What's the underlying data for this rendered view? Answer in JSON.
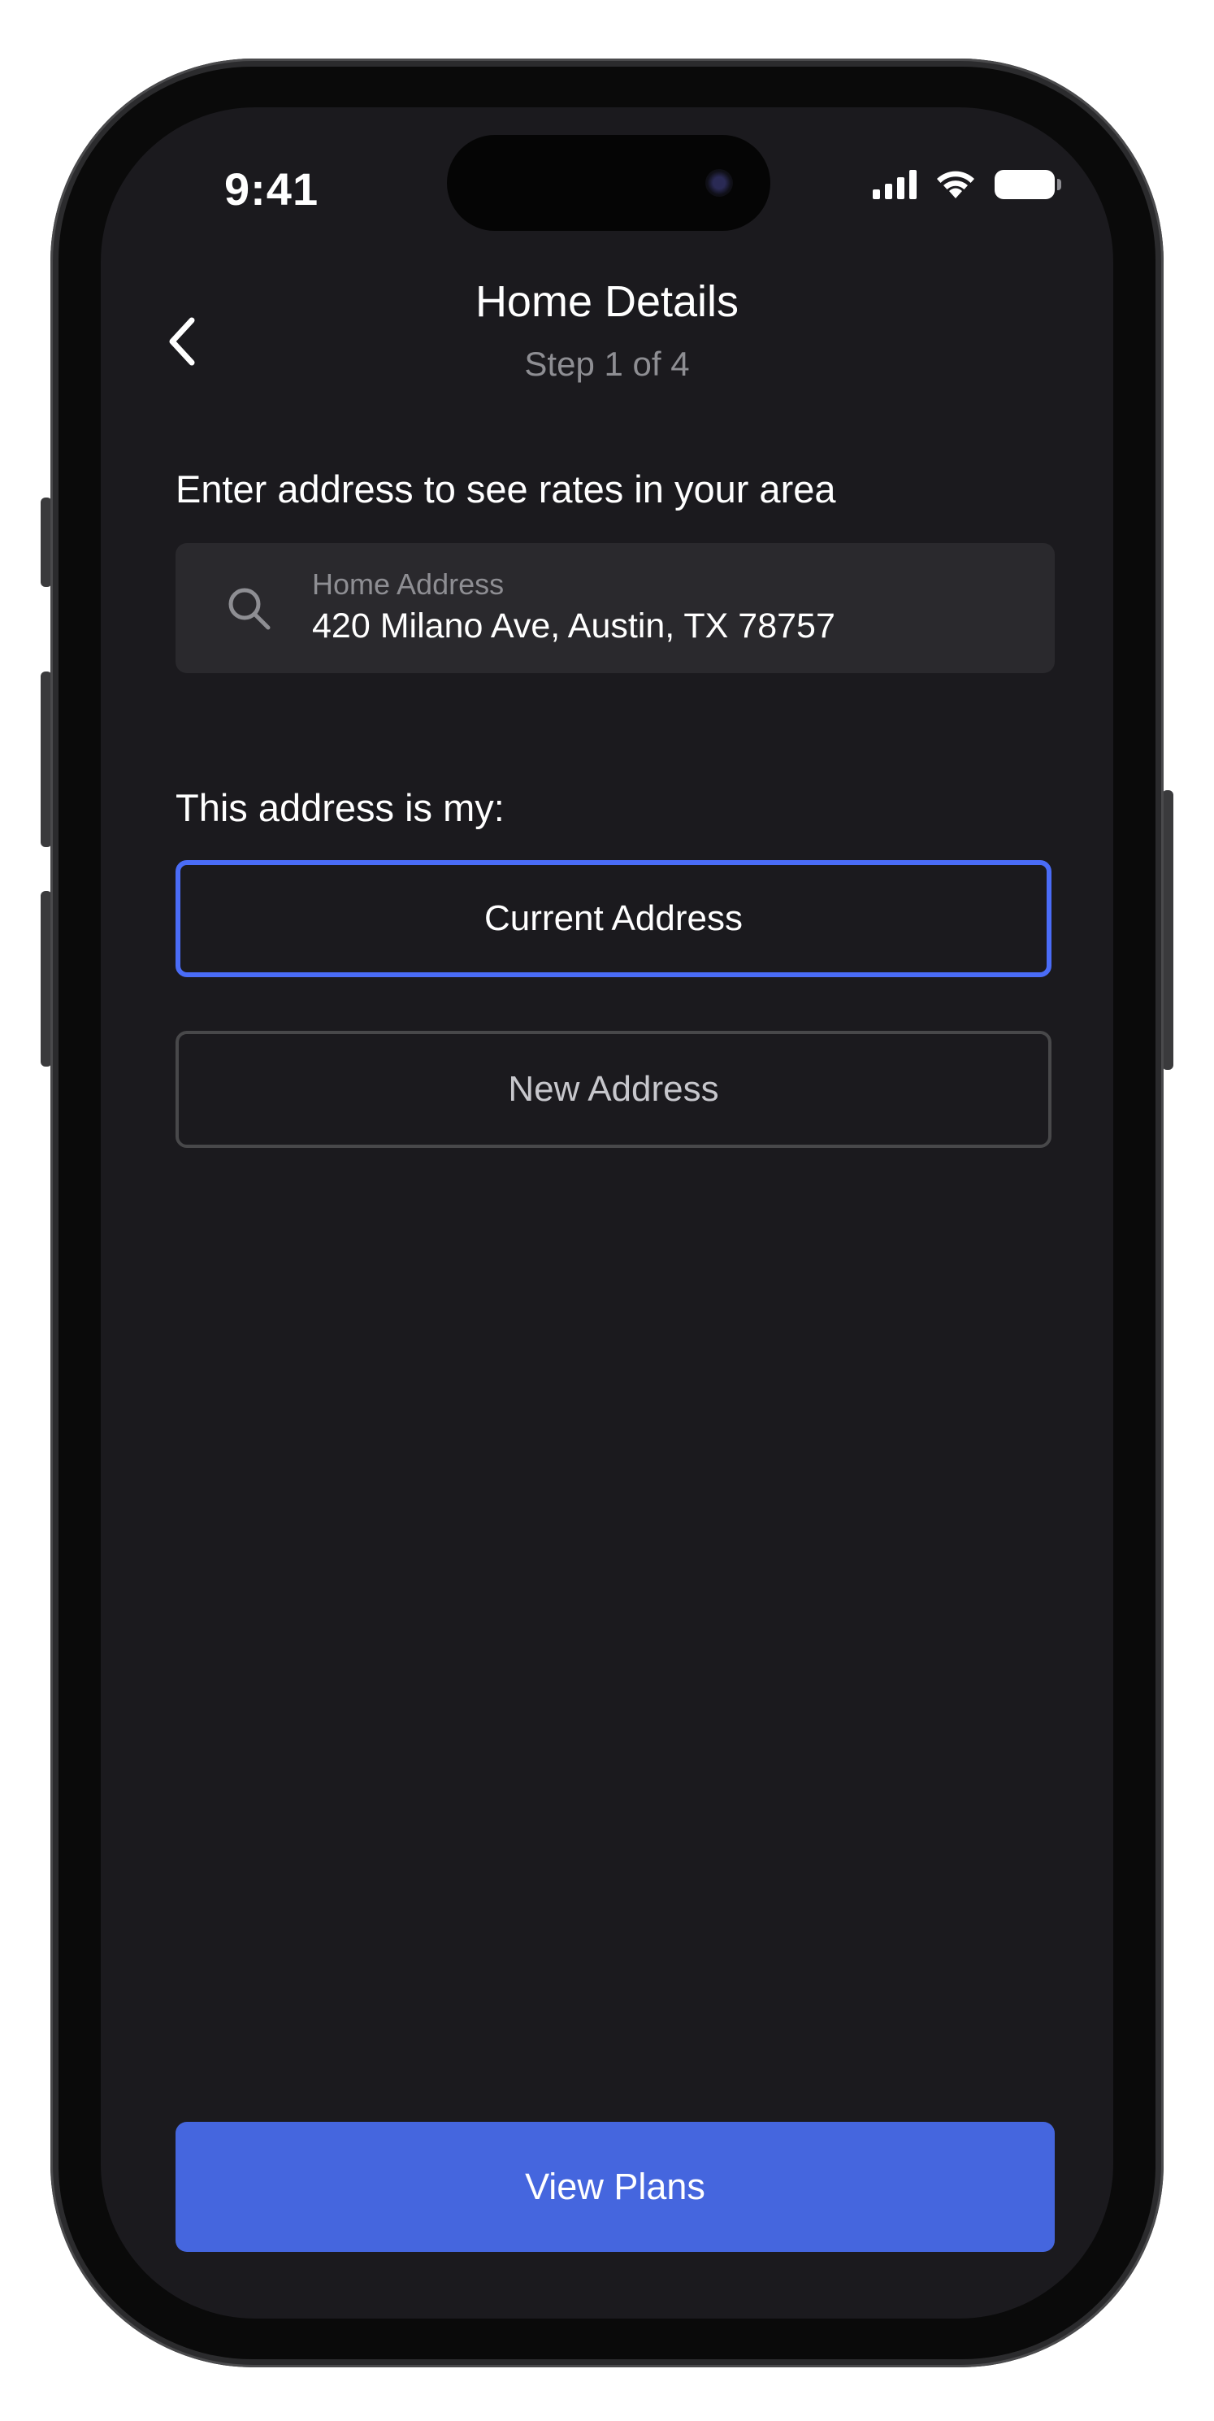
{
  "status_bar": {
    "time": "9:41"
  },
  "header": {
    "title": "Home Details",
    "subtitle": "Step 1 of 4",
    "back_icon": "chevron-left-icon"
  },
  "address_section": {
    "prompt": "Enter address to see rates in your area",
    "field_label": "Home Address",
    "field_value": "420 Milano Ave, Austin, TX 78757",
    "icon": "search-icon"
  },
  "address_type": {
    "label": "This address is my:",
    "options": [
      {
        "label": "Current Address",
        "selected": true
      },
      {
        "label": "New Address",
        "selected": false
      }
    ]
  },
  "footer": {
    "cta_label": "View Plans"
  },
  "colors": {
    "background": "#1b1a1e",
    "accent": "#4566de",
    "selected_border": "#4a6cf7",
    "field_bg": "#2a292d"
  }
}
